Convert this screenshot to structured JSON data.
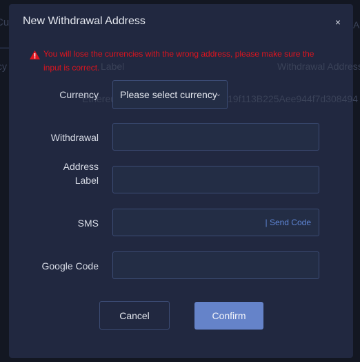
{
  "background": {
    "tab_fragment": "Cur",
    "tab_right_fragment": "Al",
    "col_currency_fragment": "cy",
    "col_label": "Label",
    "col_address": "Withdrawal Address",
    "row_currency_fragment": "Ethereu",
    "row_address_fragment": "19f113B225Aee944f7d308494"
  },
  "modal": {
    "title": "New Withdrawal Address",
    "close": "×",
    "warning": "You will lose the currencies with the wrong address, please make sure the input is correct.",
    "warning_color": "#e0141e",
    "fields": [
      {
        "label": "Currency",
        "value": "Please select currency"
      },
      {
        "label": "Withdrawal",
        "value": ""
      },
      {
        "label": "Address Label",
        "value": ""
      },
      {
        "label": "SMS",
        "value": "",
        "action": "| Send Code"
      },
      {
        "label": "Google Code",
        "value": ""
      }
    ],
    "cancel": "Cancel",
    "confirm": "Confirm",
    "accent": "#6583c9"
  }
}
